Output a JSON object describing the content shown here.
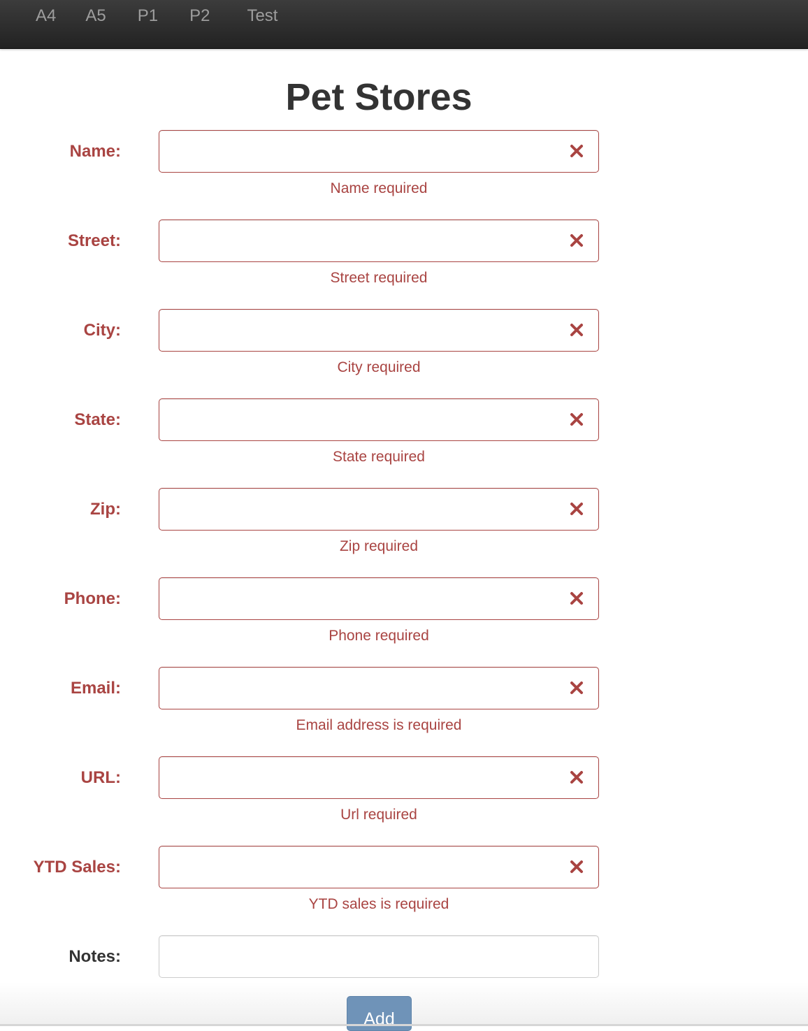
{
  "nav": {
    "items": [
      {
        "label": "A4"
      },
      {
        "label": "A5"
      },
      {
        "label": "P1"
      },
      {
        "label": "P2"
      },
      {
        "label": "Test"
      }
    ]
  },
  "page": {
    "title": "Pet Stores"
  },
  "form": {
    "fields": [
      {
        "label": "Name:",
        "value": "",
        "help": "Name required"
      },
      {
        "label": "Street:",
        "value": "",
        "help": "Street required"
      },
      {
        "label": "City:",
        "value": "",
        "help": "City required"
      },
      {
        "label": "State:",
        "value": "",
        "help": "State required"
      },
      {
        "label": "Zip:",
        "value": "",
        "help": "Zip required"
      },
      {
        "label": "Phone:",
        "value": "",
        "help": "Phone required"
      },
      {
        "label": "Email:",
        "value": "",
        "help": "Email address is required"
      },
      {
        "label": "URL:",
        "value": "",
        "help": "Url required"
      },
      {
        "label": "YTD Sales:",
        "value": "",
        "help": "YTD sales is required"
      }
    ],
    "notes": {
      "label": "Notes:",
      "value": ""
    },
    "submit_label": "Add"
  },
  "colors": {
    "error": "#a94442",
    "navbar": "#222222",
    "nav_text": "#9d9d9d",
    "button": "#6f93b8"
  },
  "icons": {
    "field_error": "close-icon"
  }
}
